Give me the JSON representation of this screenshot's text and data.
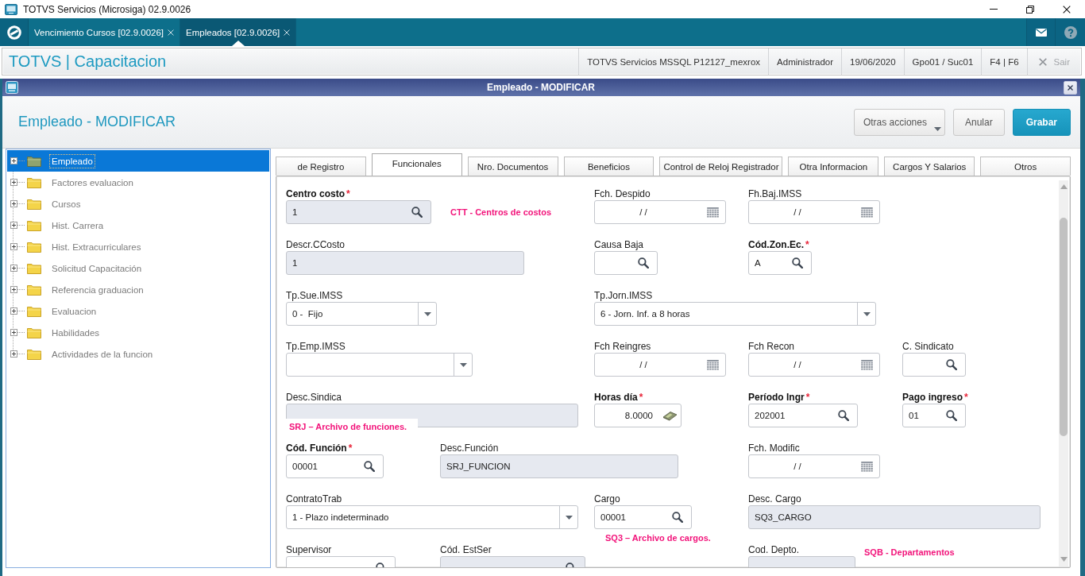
{
  "window": {
    "title": "TOTVS Servicios (Microsiga) 02.9.0026"
  },
  "app_tabs": [
    {
      "label": "Vencimiento Cursos [02.9.0026]",
      "selected": false
    },
    {
      "label": "Empleados [02.9.0026]",
      "selected": true
    }
  ],
  "header": {
    "brand": "TOTVS | Capacitacion",
    "info": [
      "TOTVS Servicios MSSQL P12127_mexrox",
      "Administrador",
      "19/06/2020",
      "Gpo01 / Suc01",
      "F4 | F6"
    ],
    "exit": {
      "label": "Sair",
      "disabled": true
    }
  },
  "dialog": {
    "title": "Empleado - MODIFICAR",
    "heading": "Empleado - MODIFICAR",
    "buttons": [
      {
        "label": "Otras acciones",
        "kind": "menu"
      },
      {
        "label": "Anular",
        "kind": "secondary"
      },
      {
        "label": "Grabar",
        "kind": "primary"
      }
    ]
  },
  "tree": {
    "items": [
      {
        "label": "Empleado",
        "selected": true,
        "expanded": false
      },
      {
        "label": "Factores evaluacion",
        "selected": false,
        "expanded": false
      },
      {
        "label": "Cursos",
        "selected": false,
        "expanded": false
      },
      {
        "label": "Hist. Carrera",
        "selected": false,
        "expanded": false
      },
      {
        "label": "Hist. Extracurriculares",
        "selected": false,
        "expanded": false
      },
      {
        "label": "Solicitud Capacitación",
        "selected": false,
        "expanded": false
      },
      {
        "label": "Referencia graduacion",
        "selected": false,
        "expanded": false
      },
      {
        "label": "Evaluacion",
        "selected": false,
        "expanded": false
      },
      {
        "label": "Habilidades",
        "selected": false,
        "expanded": false
      },
      {
        "label": "Actividades de la funcion",
        "selected": false,
        "expanded": false
      }
    ]
  },
  "form_tabs": [
    {
      "label": "de Registro",
      "selected": false
    },
    {
      "label": "Funcionales",
      "selected": true
    },
    {
      "label": "Nro. Documentos",
      "selected": false
    },
    {
      "label": "Beneficios",
      "selected": false
    },
    {
      "label": "Control de Reloj Registrador",
      "selected": false
    },
    {
      "label": "Otra Informacion",
      "selected": false
    },
    {
      "label": "Cargos Y Salarios",
      "selected": false
    },
    {
      "label": "Otros",
      "selected": false
    }
  ],
  "form": {
    "rows": [
      {
        "fields": [
          {
            "label": "Centro costo",
            "required_mark": "*",
            "kind": "lookup",
            "value": "1",
            "readonly": true
          },
          {
            "label": "Fch. Despido",
            "kind": "date",
            "value": "/ /",
            "readonly": false
          },
          {
            "label": "Fh.Baj.IMSS",
            "kind": "date",
            "value": "/ /",
            "readonly": false
          }
        ]
      },
      {
        "fields": [
          {
            "label": "Descr.CCosto",
            "kind": "text",
            "value": "1",
            "readonly": true
          },
          {
            "label": "Causa Baja",
            "kind": "lookup",
            "readonly": false
          },
          {
            "label": "Cód.Zon.Ec.",
            "required_mark": "*",
            "kind": "lookup",
            "value": "A",
            "readonly": false
          }
        ]
      },
      {
        "fields": [
          {
            "label": "Tp.Sue.IMSS",
            "kind": "select",
            "value": "0 -  Fijo",
            "readonly": false
          },
          {
            "label": "Tp.Jorn.IMSS",
            "kind": "select",
            "value": "6 - Jorn. Inf. a 8 horas",
            "readonly": false
          }
        ]
      },
      {
        "fields": [
          {
            "label": "Tp.Emp.IMSS",
            "kind": "select",
            "readonly": false
          },
          {
            "label": "Fch Reingres",
            "kind": "date",
            "value": "/ /",
            "readonly": false
          },
          {
            "label": "Fch Recon",
            "kind": "date",
            "value": "/ /",
            "readonly": false
          },
          {
            "label": "C. Sindicato",
            "kind": "lookup",
            "readonly": false
          }
        ]
      },
      {
        "fields": [
          {
            "label": "Desc.Sindica",
            "kind": "text",
            "readonly": true
          },
          {
            "label": "Horas día",
            "required_mark": "*",
            "kind": "number",
            "value": "8.0000",
            "readonly": false
          },
          {
            "label": "Período Ingr",
            "required_mark": "*",
            "kind": "lookup",
            "value": "202001",
            "readonly": false
          },
          {
            "label": "Pago ingreso",
            "required_mark": "*",
            "kind": "lookup",
            "value": "01",
            "readonly": false
          }
        ]
      },
      {
        "fields": [
          {
            "label": "Cód. Función",
            "required_mark": "*",
            "kind": "lookup",
            "value": "00001",
            "readonly": false
          },
          {
            "label": "Desc.Función",
            "kind": "text",
            "value": "SRJ_FUNCION",
            "readonly": true
          },
          {
            "label": "Fch. Modific",
            "kind": "date",
            "value": "/ /",
            "readonly": false
          }
        ]
      },
      {
        "fields": [
          {
            "label": "ContratoTrab",
            "kind": "select",
            "value": "1 - Plazo indeterminado",
            "readonly": false
          },
          {
            "label": "Cargo",
            "kind": "lookup",
            "value": "00001",
            "readonly": false
          },
          {
            "label": "Desc. Cargo",
            "kind": "text",
            "value": "SQ3_CARGO",
            "readonly": true
          }
        ]
      },
      {
        "fields": [
          {
            "label": "Supervisor",
            "kind": "lookup",
            "readonly": false
          },
          {
            "label": "Cód. EstSer",
            "kind": "lookup",
            "readonly": true
          },
          {
            "label": "Cod. Depto.",
            "kind": "text",
            "readonly": true
          }
        ]
      }
    ]
  },
  "notes": [
    "CTT - Centros de costos",
    "SRJ – Archivo de funciones.",
    "SQ3 – Archivo de cargos.",
    "SQB - Departamentos"
  ]
}
